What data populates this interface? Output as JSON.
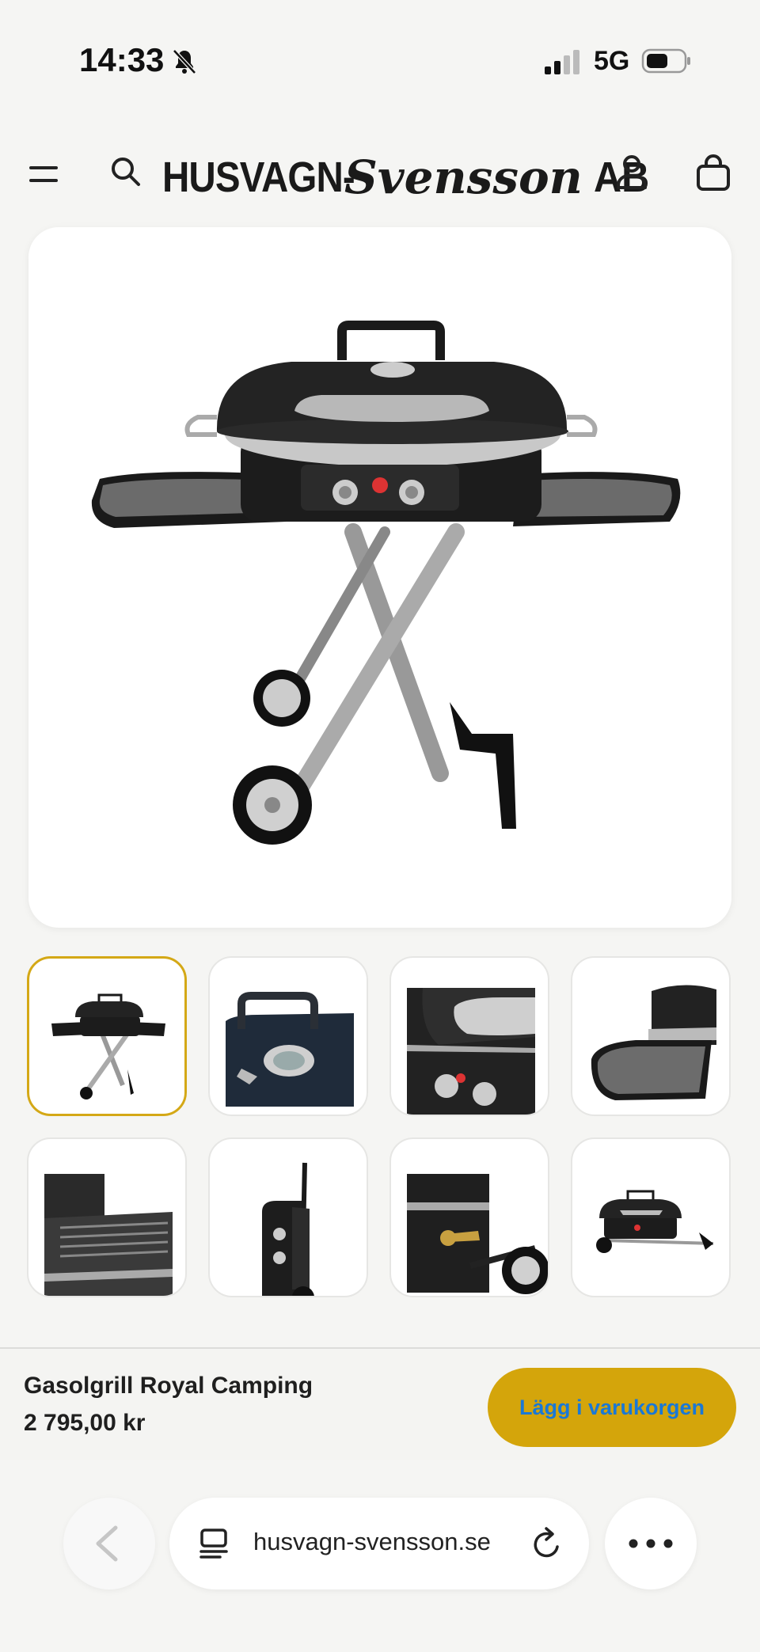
{
  "status_bar": {
    "time": "14:33",
    "network": "5G",
    "icons": [
      "bell-slash-icon",
      "signal-icon",
      "battery-icon"
    ]
  },
  "header": {
    "logo_part1": "HUSVAGN-",
    "logo_part2": "Svensson",
    "logo_part3": "AB",
    "icons": [
      "menu-icon",
      "search-icon",
      "account-icon",
      "cart-icon"
    ]
  },
  "gallery": {
    "main_image_alt": "Gasolgrill Royal Camping",
    "thumbnails": [
      {
        "name": "grill-full-view",
        "active": true
      },
      {
        "name": "lid-handle-thermometer",
        "active": false
      },
      {
        "name": "control-knobs",
        "active": false
      },
      {
        "name": "side-table",
        "active": false
      },
      {
        "name": "grill-grate-open",
        "active": false
      },
      {
        "name": "grill-folded-side",
        "active": false
      },
      {
        "name": "gas-connector",
        "active": false
      },
      {
        "name": "grill-folded-trolley",
        "active": false
      }
    ]
  },
  "product": {
    "name": "Gasolgrill Royal Camping",
    "price": "2 795,00 kr",
    "add_to_cart_label": "Lägg i varukorgen"
  },
  "browser": {
    "url": "husvagn-svensson.se",
    "icons": [
      "back-arrow-icon",
      "reader-icon",
      "reload-icon",
      "more-icon"
    ]
  },
  "colors": {
    "accent": "#d4a50b",
    "button_text": "#1a78d6",
    "background": "#f5f5f3"
  }
}
